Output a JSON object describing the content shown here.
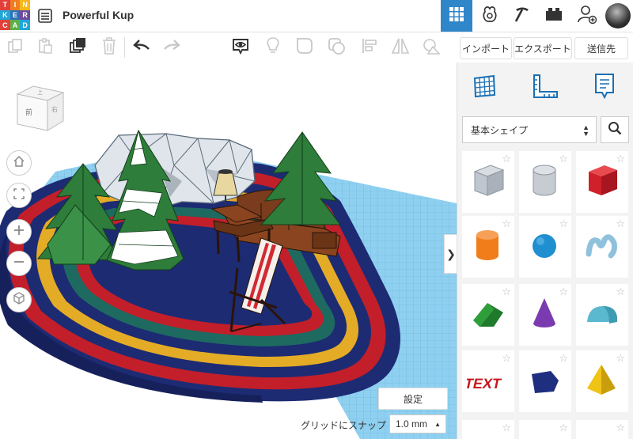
{
  "app": {
    "logo_letters": [
      "T",
      "I",
      "N",
      "K",
      "E",
      "R",
      "C",
      "A",
      "D"
    ],
    "logo_colors": [
      "#e2403b",
      "#f07d23",
      "#f5b71a",
      "#1fa7d8",
      "#2e71b8",
      "#6c4c9c",
      "#e2403b",
      "#5cb246",
      "#1fa7d8"
    ],
    "design_title": "Powerful Kup"
  },
  "topbar": {
    "icons": [
      "grid-view-icon",
      "gallery-icon",
      "pickaxe-icon",
      "blocks-icon",
      "add-user-icon"
    ],
    "active_color": "#2f86c9"
  },
  "actions": {
    "import_label": "インポート",
    "export_label": "エクスポート",
    "send_label": "送信先"
  },
  "viewcube": {
    "front_label": "前",
    "right_label": "右",
    "top_label": "上"
  },
  "workplane": {
    "settings_label": "設定",
    "snap_label": "グリッドにスナップ",
    "snap_value": "1.0 mm"
  },
  "shapes_panel": {
    "library_label": "基本シェイプ",
    "shapes": [
      {
        "name": "box-hole-icon",
        "color": "#bfc6cf"
      },
      {
        "name": "cylinder-hole-icon",
        "color": "#c7ccd2"
      },
      {
        "name": "box-icon",
        "color": "#d0202a"
      },
      {
        "name": "cylinder-icon",
        "color": "#f07d1a"
      },
      {
        "name": "sphere-icon",
        "color": "#1f8fd0"
      },
      {
        "name": "scribble-icon",
        "color": "#8fc1dd"
      },
      {
        "name": "roof-icon",
        "color": "#2e9e3a"
      },
      {
        "name": "cone-icon",
        "color": "#7b3bb0"
      },
      {
        "name": "round-roof-icon",
        "color": "#5bb9cf"
      },
      {
        "name": "text-icon",
        "color": "#c5171f"
      },
      {
        "name": "polygon-icon",
        "color": "#1f2f80"
      },
      {
        "name": "pyramid-icon",
        "color": "#f0c417"
      }
    ]
  },
  "colors": {
    "rug_navy": "#1d2b73",
    "rug_red": "#c21f2a",
    "rug_yellow": "#e4ac26",
    "rug_green": "#1e6a60",
    "grid_blue": "#8fd0f0",
    "tree_green": "#2e7d3a",
    "sofa_brown": "#7a3c1c"
  }
}
